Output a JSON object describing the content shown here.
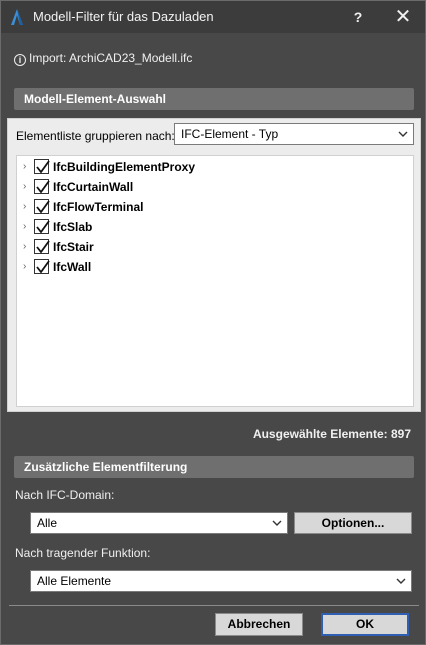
{
  "window": {
    "title": "Modell-Filter für das Dazuladen",
    "help_label": "?",
    "close_label": "✕"
  },
  "import": {
    "text": "Import: ArchiCAD23_Modell.ifc"
  },
  "element_selection": {
    "header": "Modell-Element-Auswahl",
    "group_label": "Elementliste gruppieren nach:",
    "group_value": "IFC-Element - Typ",
    "items": [
      {
        "label": "IfcBuildingElementProxy",
        "checked": true
      },
      {
        "label": "IfcCurtainWall",
        "checked": true
      },
      {
        "label": "IfcFlowTerminal",
        "checked": true
      },
      {
        "label": "IfcSlab",
        "checked": true
      },
      {
        "label": "IfcStair",
        "checked": true
      },
      {
        "label": "IfcWall",
        "checked": true
      }
    ],
    "count_text": "Ausgewählte Elemente: 897"
  },
  "additional_filter": {
    "header": "Zusätzliche Elementfilterung",
    "domain_label": "Nach IFC-Domain:",
    "domain_value": "Alle",
    "options_label": "Optionen...",
    "function_label": "Nach tragender Funktion:",
    "function_value": "Alle Elemente"
  },
  "footer": {
    "cancel_label": "Abbrechen",
    "ok_label": "OK"
  },
  "colors": {
    "window_bg": "#484848",
    "titlebar_bg": "#3c3c3c",
    "section_bg": "#6f6f6f",
    "panel_bg": "#ececec",
    "ok_border": "#2f5fb3"
  }
}
